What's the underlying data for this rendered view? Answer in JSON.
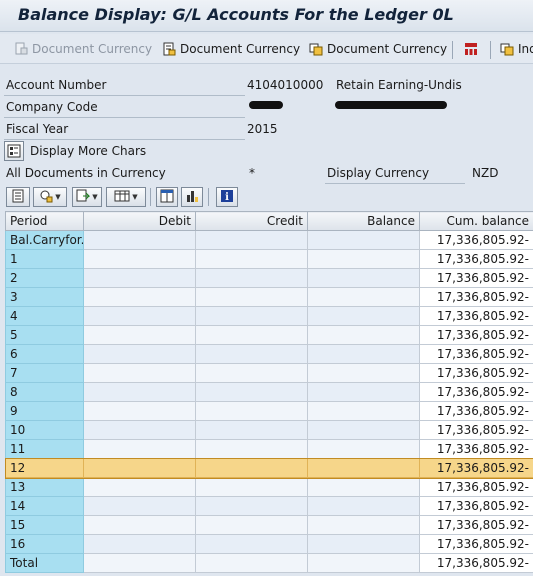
{
  "window": {
    "title": "Balance Display: G/L Accounts For the Ledger 0L"
  },
  "app_toolbar": {
    "buttons": [
      {
        "label": "Document Currency",
        "icon": "document-currency-icon",
        "enabled": false
      },
      {
        "label": "Document Currency",
        "icon": "document-currency-icon",
        "enabled": true
      },
      {
        "label": "Document Currency",
        "icon": "document-currency-icon",
        "enabled": true
      },
      {
        "label": "Ind",
        "icon": "individual-display-icon",
        "enabled": true
      }
    ]
  },
  "header": {
    "account_number_label": "Account Number",
    "account_number": "4104010000",
    "account_text": "Retain Earning-Undis",
    "company_code_label": "Company Code",
    "fiscal_year_label": "Fiscal Year",
    "fiscal_year": "2015",
    "more_chars_label": "Display More Chars",
    "all_docs_label": "All Documents in Currency",
    "all_docs_value": "*",
    "display_currency_label": "Display Currency",
    "display_currency_value": "NZD"
  },
  "grid": {
    "columns": [
      "Period",
      "Debit",
      "Credit",
      "Balance",
      "Cum. balance"
    ],
    "rows": [
      {
        "period": "Bal.Carryfor...",
        "debit": "",
        "credit": "",
        "balance": "",
        "cum": "17,336,805.92-"
      },
      {
        "period": "1",
        "debit": "",
        "credit": "",
        "balance": "",
        "cum": "17,336,805.92-"
      },
      {
        "period": "2",
        "debit": "",
        "credit": "",
        "balance": "",
        "cum": "17,336,805.92-"
      },
      {
        "period": "3",
        "debit": "",
        "credit": "",
        "balance": "",
        "cum": "17,336,805.92-"
      },
      {
        "period": "4",
        "debit": "",
        "credit": "",
        "balance": "",
        "cum": "17,336,805.92-"
      },
      {
        "period": "5",
        "debit": "",
        "credit": "",
        "balance": "",
        "cum": "17,336,805.92-"
      },
      {
        "period": "6",
        "debit": "",
        "credit": "",
        "balance": "",
        "cum": "17,336,805.92-"
      },
      {
        "period": "7",
        "debit": "",
        "credit": "",
        "balance": "",
        "cum": "17,336,805.92-"
      },
      {
        "period": "8",
        "debit": "",
        "credit": "",
        "balance": "",
        "cum": "17,336,805.92-"
      },
      {
        "period": "9",
        "debit": "",
        "credit": "",
        "balance": "",
        "cum": "17,336,805.92-"
      },
      {
        "period": "10",
        "debit": "",
        "credit": "",
        "balance": "",
        "cum": "17,336,805.92-"
      },
      {
        "period": "11",
        "debit": "",
        "credit": "",
        "balance": "",
        "cum": "17,336,805.92-"
      },
      {
        "period": "12",
        "debit": "",
        "credit": "",
        "balance": "",
        "cum": "17,336,805.92-",
        "selected": true
      },
      {
        "period": "13",
        "debit": "",
        "credit": "",
        "balance": "",
        "cum": "17,336,805.92-"
      },
      {
        "period": "14",
        "debit": "",
        "credit": "",
        "balance": "",
        "cum": "17,336,805.92-"
      },
      {
        "period": "15",
        "debit": "",
        "credit": "",
        "balance": "",
        "cum": "17,336,805.92-"
      },
      {
        "period": "16",
        "debit": "",
        "credit": "",
        "balance": "",
        "cum": "17,336,805.92-"
      },
      {
        "period": "Total",
        "debit": "",
        "credit": "",
        "balance": "",
        "cum": "17,336,805.92-"
      }
    ]
  },
  "colors": {
    "period_column": "#a8dff1",
    "selected_row": "#f6d68a",
    "title_text": "#12233a"
  }
}
